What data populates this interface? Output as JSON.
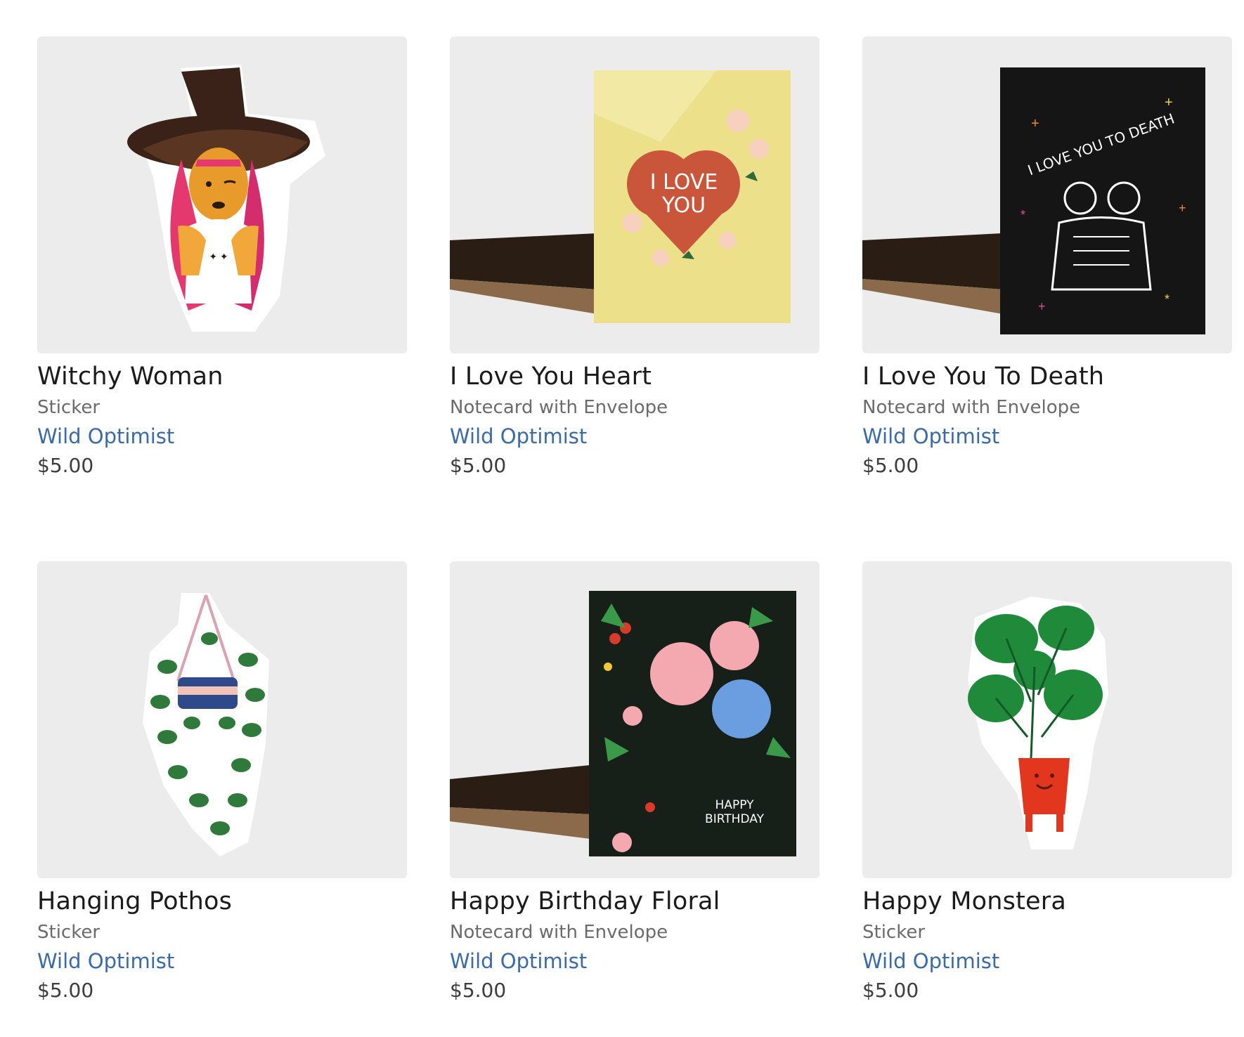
{
  "products": [
    {
      "title": "Witchy Woman",
      "type": "Sticker",
      "brand": "Wild Optimist",
      "price": "$5.00",
      "image_text": ""
    },
    {
      "title": "I Love You Heart",
      "type": "Notecard with Envelope",
      "brand": "Wild Optimist",
      "price": "$5.00",
      "image_text": "I LOVE YOU"
    },
    {
      "title": "I Love You To Death",
      "type": "Notecard with Envelope",
      "brand": "Wild Optimist",
      "price": "$5.00",
      "image_text": "I LOVE YOU TO DEATH"
    },
    {
      "title": "Hanging Pothos",
      "type": "Sticker",
      "brand": "Wild Optimist",
      "price": "$5.00",
      "image_text": ""
    },
    {
      "title": "Happy Birthday Floral",
      "type": "Notecard with Envelope",
      "brand": "Wild Optimist",
      "price": "$5.00",
      "image_text": "HAPPY BIRTHDAY"
    },
    {
      "title": "Happy Monstera",
      "type": "Sticker",
      "brand": "Wild Optimist",
      "price": "$5.00",
      "image_text": ""
    }
  ],
  "colors": {
    "brand_link": "#3a6aa8",
    "title": "#1b1b1b",
    "subtext": "#6b6b6b",
    "thumb_bg": "#ececec"
  }
}
